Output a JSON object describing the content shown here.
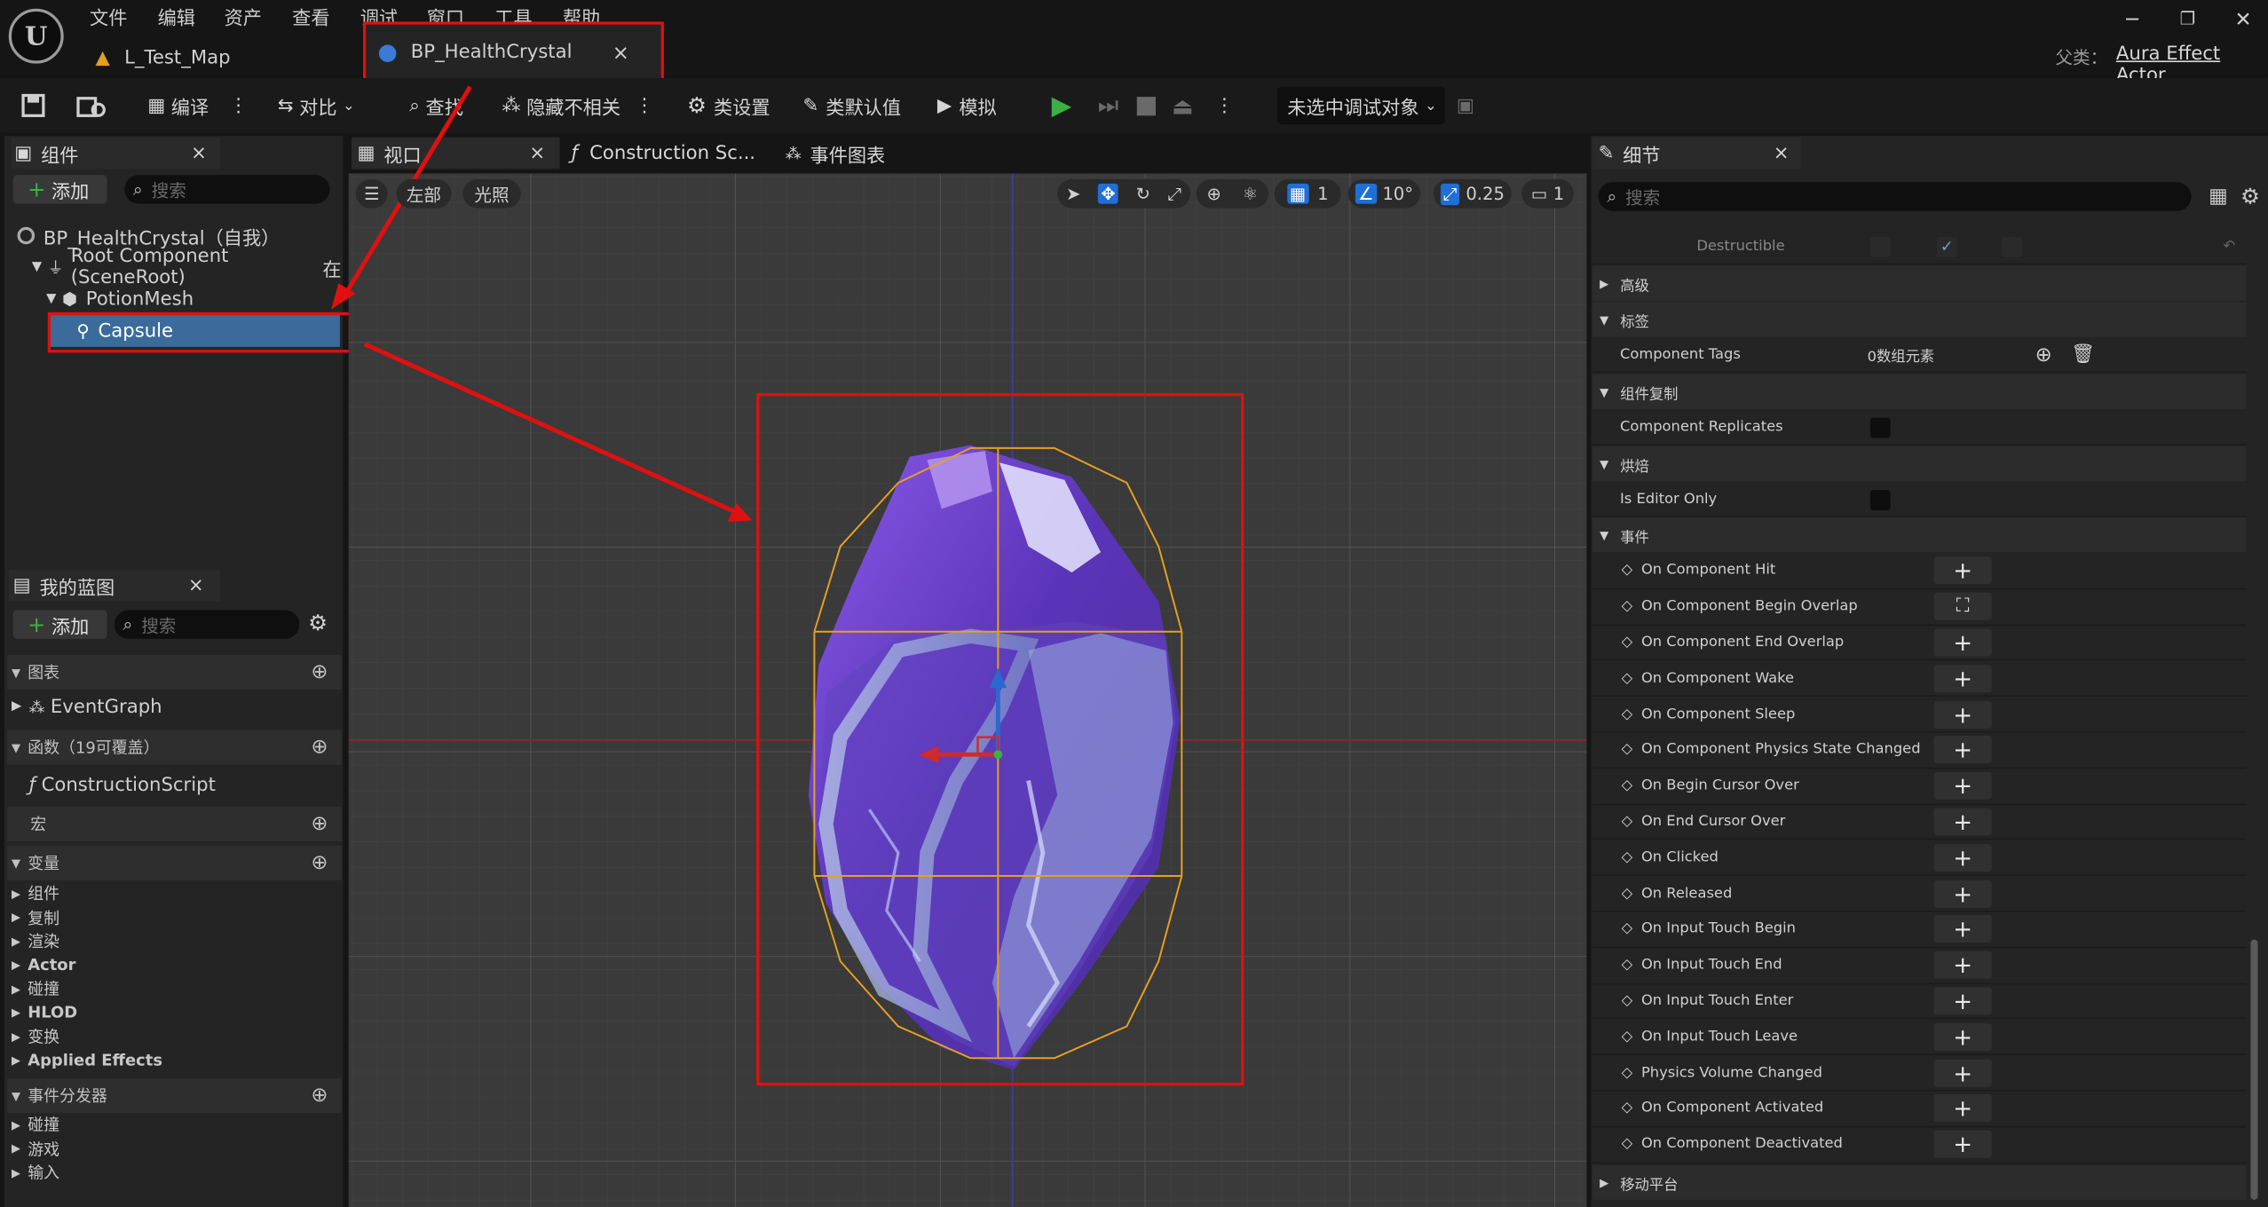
{
  "menu": [
    "文件",
    "编辑",
    "资产",
    "查看",
    "调试",
    "窗口",
    "工具",
    "帮助"
  ],
  "logo": "U",
  "tabs": [
    {
      "label": "L_Test_Map"
    },
    {
      "label": "BP_HealthCrystal",
      "close": "×"
    }
  ],
  "parent_class": {
    "label": "父类：",
    "value": "Aura Effect Actor"
  },
  "window_controls": [
    "─",
    "❐",
    "✕"
  ],
  "toolbar": {
    "compile": "编译",
    "diff": "对比",
    "find": "查找",
    "hide_unrelated": "隐藏不相关",
    "class_settings": "类设置",
    "class_defaults": "类默认值",
    "simulate": "模拟",
    "debug_target": "未选中调试对象"
  },
  "components_panel": {
    "title": "组件",
    "close": "×",
    "add": "添加",
    "search_placeholder": "搜索",
    "tree": [
      {
        "label": "BP_HealthCrystal（自我）"
      },
      {
        "label": "Root Component (SceneRoot)",
        "suffix": "在"
      },
      {
        "label": "PotionMesh"
      },
      {
        "label": "Capsule"
      }
    ]
  },
  "my_blueprint": {
    "title": "我的蓝图",
    "close": "×",
    "add": "添加",
    "search_placeholder": "搜索",
    "graphs": "图表",
    "event_graph": "EventGraph",
    "functions": "函数（19可覆盖）",
    "construction_script": "ConstructionScript",
    "macros": "宏",
    "variables": "变量",
    "variable_items": [
      "组件",
      "复制",
      "渲染",
      "Actor",
      "碰撞",
      "HLOD",
      "变换",
      "Applied Effects"
    ],
    "dispatchers": "事件分发器",
    "dispatcher_items": [
      "碰撞",
      "游戏",
      "输入"
    ]
  },
  "viewport_tabs": [
    {
      "label": "视口",
      "close": "×"
    },
    {
      "label": "Construction Sc..."
    },
    {
      "label": "事件图表"
    }
  ],
  "viewport": {
    "view_mode": "左部",
    "lighting": "光照",
    "grid_snap": "1",
    "rot_snap": "10°",
    "scale_snap": "0.25",
    "camera_speed": "1"
  },
  "details": {
    "title": "细节",
    "close": "×",
    "search_placeholder": "搜索",
    "destructible": "Destructible",
    "advanced": "高级",
    "tags_section": "标签",
    "component_tags": "Component Tags",
    "component_tags_value": "0数组元素",
    "replication_section": "组件复制",
    "component_replicates": "Component Replicates",
    "cooking_section": "烘焙",
    "is_editor_only": "Is Editor Only",
    "events_section": "事件",
    "events": [
      "On Component Hit",
      "On Component Begin Overlap",
      "On Component End Overlap",
      "On Component Wake",
      "On Component Sleep",
      "On Component Physics State Changed",
      "On Begin Cursor Over",
      "On End Cursor Over",
      "On Clicked",
      "On Released",
      "On Input Touch Begin",
      "On Input Touch End",
      "On Input Touch Enter",
      "On Input Touch Leave",
      "Physics Volume Changed",
      "On Component Activated",
      "On Component Deactivated"
    ],
    "mobile_platform": "移动平台"
  },
  "colors": {
    "accent": "#e01010",
    "selection": "#3b6b9a",
    "capsule": "#e8a020",
    "crystal": "#6b3fd0"
  }
}
